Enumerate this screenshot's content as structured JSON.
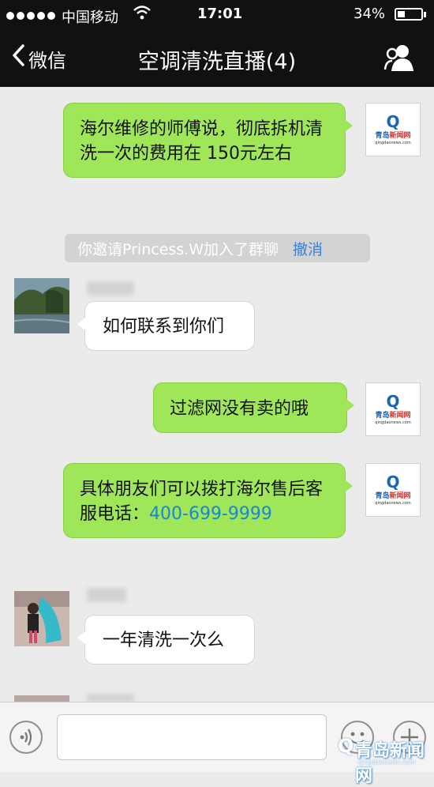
{
  "status_bar": {
    "carrier": "中国移动",
    "time": "17:01",
    "battery": "34%"
  },
  "nav": {
    "back_label": "微信",
    "title": "空调清洗直播(4)"
  },
  "avatar_brand": {
    "letter": "Q",
    "name_a": "青岛",
    "name_b": "新闻网",
    "url": "qingdaonews.com"
  },
  "messages": [
    {
      "type": "outgoing",
      "text": "海尔维修的师傅说，彻底拆机清洗一次的费用在 150元左右"
    },
    {
      "type": "system",
      "text": "你邀请Princess.W加入了群聊",
      "action": "撤消"
    },
    {
      "type": "incoming",
      "text": "如何联系到你们"
    },
    {
      "type": "outgoing",
      "text": "过滤网没有卖的哦"
    },
    {
      "type": "outgoing",
      "text_before": "具体朋友们可以拨打海尔售后客服电话：",
      "phone": "400-699-9999"
    },
    {
      "type": "incoming",
      "text": "一年清洗一次么"
    }
  ],
  "watermark": {
    "text": "青岛新闻网",
    "letter": "Q",
    "url": "qingdaonews.com"
  },
  "colors": {
    "bar": "#111111",
    "chat_bg": "#ebebeb",
    "outgoing_bubble": "#9fe658",
    "incoming_bubble": "#ffffff",
    "link": "#1a86d6"
  }
}
